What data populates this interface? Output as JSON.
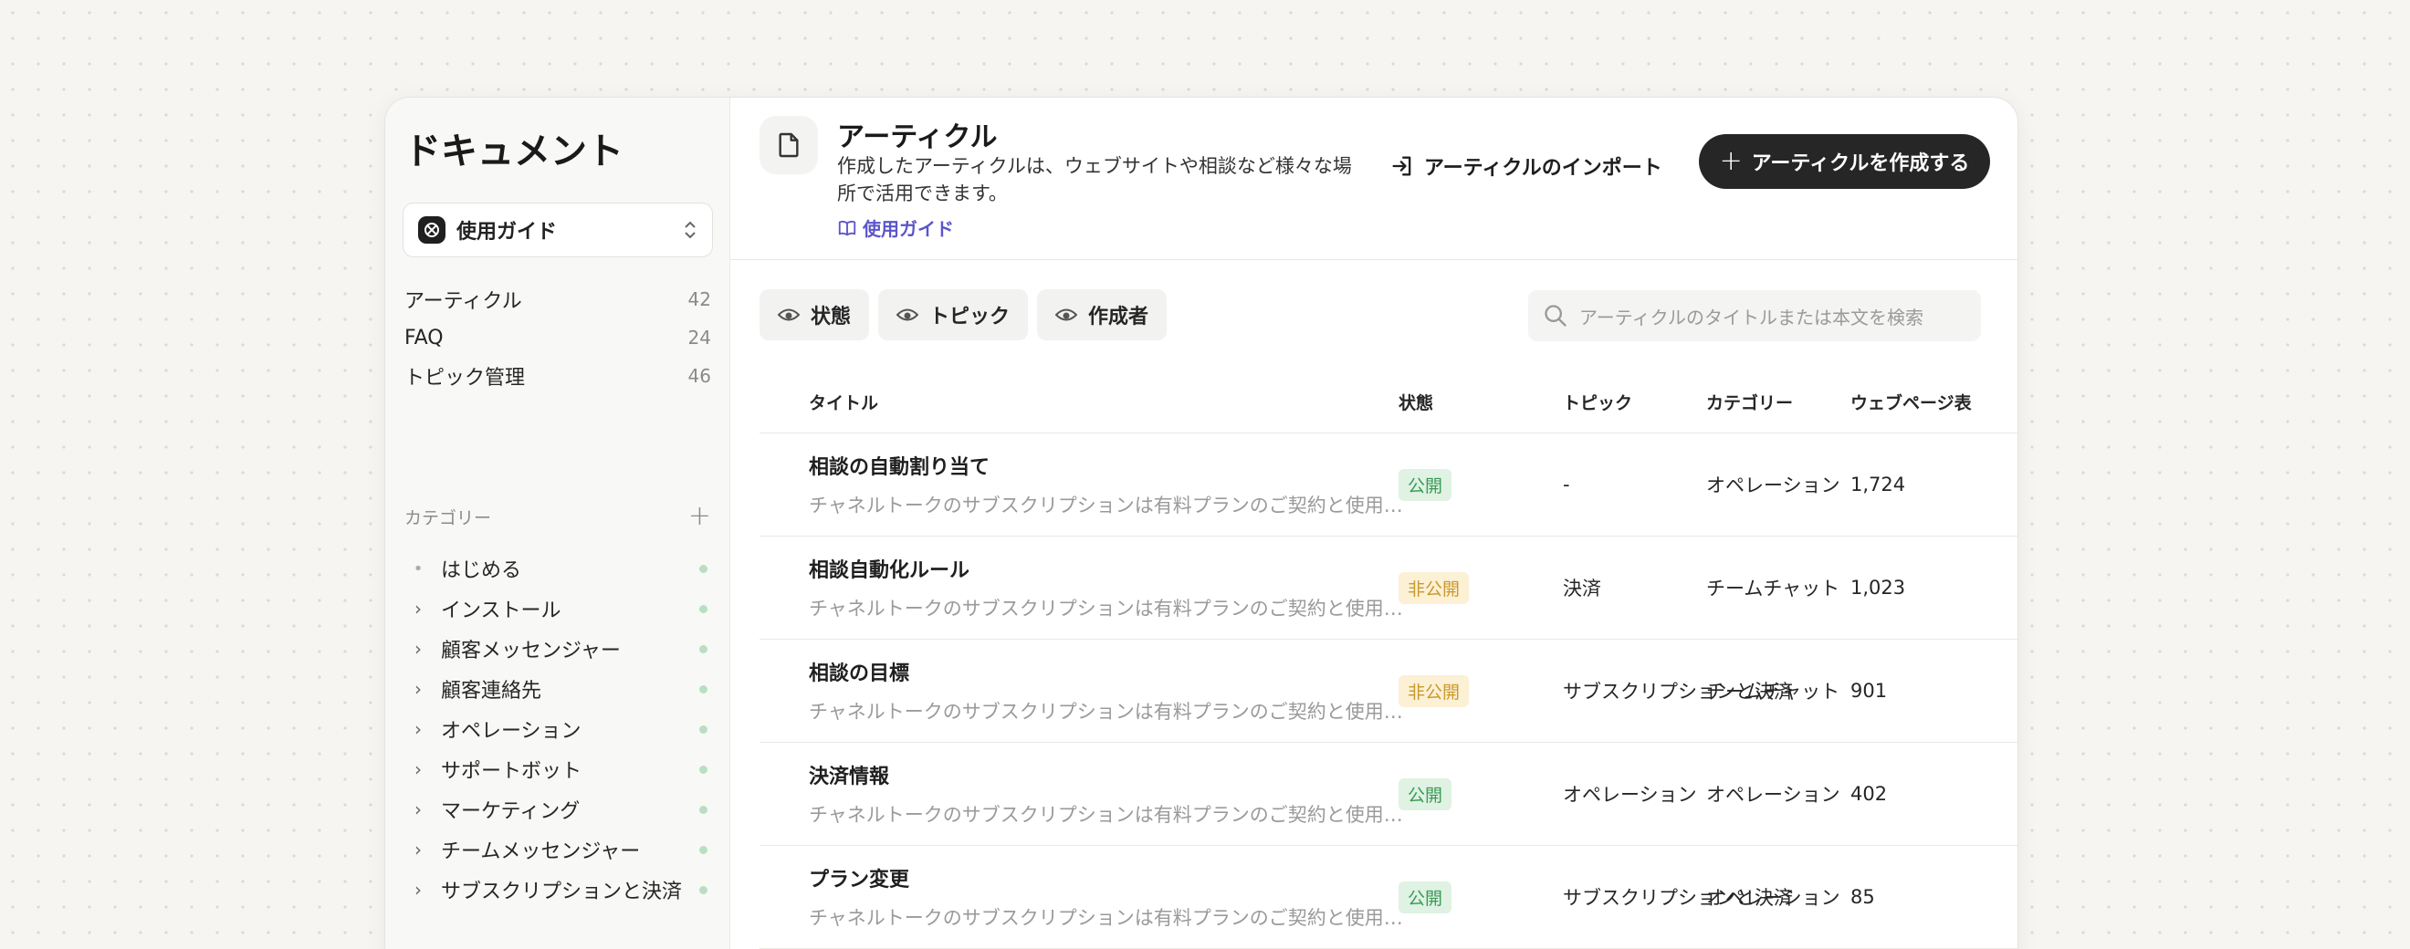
{
  "sidebar": {
    "title": "ドキュメント",
    "guide_select": "使用ガイド",
    "nav": [
      {
        "label": "アーティクル",
        "count": "42"
      },
      {
        "label": "FAQ",
        "count": "24"
      },
      {
        "label": "トピック管理",
        "count": "46"
      }
    ],
    "category_label": "カテゴリー",
    "categories": [
      {
        "name": "はじめる"
      },
      {
        "name": "インストール"
      },
      {
        "name": "顧客メッセンジャー"
      },
      {
        "name": "顧客連絡先"
      },
      {
        "name": "オペレーション"
      },
      {
        "name": "サポートボット"
      },
      {
        "name": "マーケティング"
      },
      {
        "name": "チームメッセンジャー"
      },
      {
        "name": "サブスクリプションと決済"
      }
    ]
  },
  "header": {
    "title": "アーティクル",
    "description": "作成したアーティクルは、ウェブサイトや相談など様々な場所で活用できます。",
    "guide_link": "使用ガイド",
    "import_label": "アーティクルのインポート",
    "create_label": "アーティクルを作成する"
  },
  "filters": {
    "chips": [
      "状態",
      "トピック",
      "作成者"
    ],
    "search_placeholder": "アーティクルのタイトルまたは本文を検索"
  },
  "table": {
    "columns": [
      "タイトル",
      "状態",
      "トピック",
      "カテゴリー",
      "ウェブページ表"
    ],
    "rows": [
      {
        "title": "相談の自動割り当て",
        "desc": "チャネルトークのサブスクリプションは有料プランのご契約と使用量に応じて",
        "status": "公開",
        "topic": "-",
        "category": "オペレーション",
        "views": "1,724"
      },
      {
        "title": "相談自動化ルール",
        "desc": "チャネルトークのサブスクリプションは有料プランのご契約と使用量に応じて",
        "status": "非公開",
        "topic": "決済",
        "category": "チームチャット",
        "views": "1,023"
      },
      {
        "title": "相談の目標",
        "desc": "チャネルトークのサブスクリプションは有料プランのご契約と使用量に応じて",
        "status": "非公開",
        "topic": "サブスクリプションと決済",
        "category": "チームチャット",
        "views": "901"
      },
      {
        "title": "決済情報",
        "desc": "チャネルトークのサブスクリプションは有料プランのご契約と使用量に応じて",
        "status": "公開",
        "topic": "オペレーション",
        "category": "オペレーション",
        "views": "402"
      },
      {
        "title": "プラン変更",
        "desc": "チャネルトークのサブスクリプションは有料プランのご契約と使用量に応じて",
        "status": "公開",
        "topic": "サブスクリプションと決済",
        "category": "オペレーション",
        "views": "85"
      }
    ]
  },
  "colors": {
    "accent": "#5b55c9",
    "primary_button": "#262626",
    "public_badge": "#3a9a55",
    "private_badge": "#c9992c"
  },
  "icons": [
    "chevron-right-icon",
    "document-icon",
    "book-icon",
    "import-icon",
    "plus-icon",
    "eye-icon",
    "search-icon",
    "up-down-icon"
  ]
}
